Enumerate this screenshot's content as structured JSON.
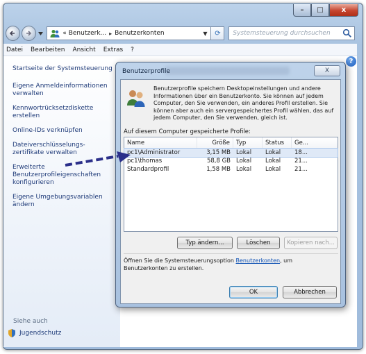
{
  "window": {
    "caption_min": "–",
    "caption_max": "□",
    "caption_close": "x"
  },
  "address": {
    "crumb_prefix": "«",
    "crumb1": "Benutzerk...",
    "crumb2": "Benutzerkonten",
    "search_placeholder": "Systemsteuerung durchsuchen"
  },
  "menu": [
    "Datei",
    "Bearbeiten",
    "Ansicht",
    "Extras",
    "?"
  ],
  "sidebar": {
    "links": [
      "Startseite der Systemsteuerung",
      "Eigene Anmeldeinformationen verwalten",
      "Kennwortrücksetzdiskette erstellen",
      "Online-IDs verknüpfen",
      "Dateiverschlüsselungs-zertifikate verwalten",
      "Erweiterte Benutzerprofileigenschaften konfigurieren",
      "Eigene Umgebungsvariablen ändern"
    ],
    "see_also": "Siehe auch",
    "parental": "Jugendschutz"
  },
  "dialog": {
    "title": "Benutzerprofile",
    "close_glyph": "X",
    "description": "Benutzerprofile speichern Desktopeinstellungen und andere Informationen über ein Benutzerkonto. Sie können auf jedem Computer, den Sie verwenden, ein anderes Profil erstellen. Sie können aber auch ein servergespeichertes Profil wählen, das auf jedem Computer, den Sie verwenden, gleich ist.",
    "list_label": "Auf diesem Computer gespeicherte Profile:",
    "columns": [
      "Name",
      "Größe",
      "Typ",
      "Status",
      "Ge..."
    ],
    "rows": [
      {
        "name": "pc1\\Administrator",
        "size": "3,15 MB",
        "typ": "Lokal",
        "status": "Lokal",
        "ge": "18..."
      },
      {
        "name": "pc1\\thomas",
        "size": "58,8 GB",
        "typ": "Lokal",
        "status": "Lokal",
        "ge": "21..."
      },
      {
        "name": "Standardprofil",
        "size": "1,58 MB",
        "typ": "Lokal",
        "status": "Lokal",
        "ge": "21..."
      }
    ],
    "btn_change_type": "Typ ändern...",
    "btn_delete": "Löschen",
    "btn_copy": "Kopieren nach...",
    "footer_pre": "Öffnen Sie die Systemsteuerungsoption ",
    "footer_link": "Benutzerkonten",
    "footer_post": ", um Benutzerkonten zu erstellen.",
    "btn_ok": "OK",
    "btn_cancel": "Abbrechen"
  },
  "colors": {
    "arrow": "#2b2f8a",
    "link": "#1e3a78"
  }
}
